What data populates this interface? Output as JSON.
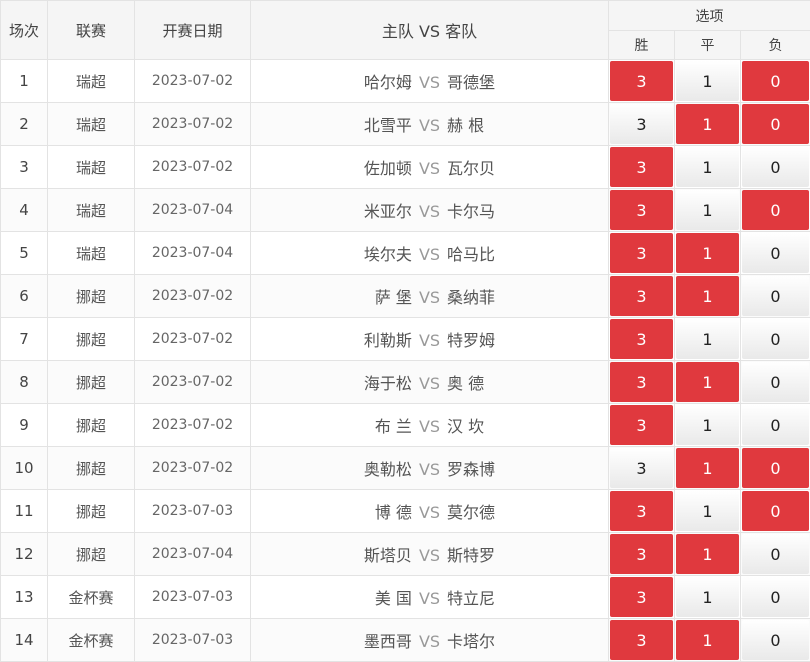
{
  "header": {
    "col_index": "场次",
    "col_league": "联赛",
    "col_date": "开赛日期",
    "col_teams": "主队 VS 客队",
    "col_options": "选项",
    "opt_win": "胜",
    "opt_draw": "平",
    "opt_loss": "负"
  },
  "colors": {
    "selected": "#e0393e",
    "unselected": "#f0f0f0"
  },
  "rows": [
    {
      "no": "1",
      "league": "瑞超",
      "date": "2023-07-02",
      "home": "哈尔姆",
      "vs": "VS",
      "away": "哥德堡",
      "win": "3",
      "draw": "1",
      "loss": "0",
      "win_sel": true,
      "draw_sel": false,
      "loss_sel": true
    },
    {
      "no": "2",
      "league": "瑞超",
      "date": "2023-07-02",
      "home": "北雪平",
      "vs": "VS",
      "away": "赫 根",
      "win": "3",
      "draw": "1",
      "loss": "0",
      "win_sel": false,
      "draw_sel": true,
      "loss_sel": true
    },
    {
      "no": "3",
      "league": "瑞超",
      "date": "2023-07-02",
      "home": "佐加顿",
      "vs": "VS",
      "away": "瓦尔贝",
      "win": "3",
      "draw": "1",
      "loss": "0",
      "win_sel": true,
      "draw_sel": false,
      "loss_sel": false
    },
    {
      "no": "4",
      "league": "瑞超",
      "date": "2023-07-04",
      "home": "米亚尔",
      "vs": "VS",
      "away": "卡尔马",
      "win": "3",
      "draw": "1",
      "loss": "0",
      "win_sel": true,
      "draw_sel": false,
      "loss_sel": true
    },
    {
      "no": "5",
      "league": "瑞超",
      "date": "2023-07-04",
      "home": "埃尔夫",
      "vs": "VS",
      "away": "哈马比",
      "win": "3",
      "draw": "1",
      "loss": "0",
      "win_sel": true,
      "draw_sel": true,
      "loss_sel": false
    },
    {
      "no": "6",
      "league": "挪超",
      "date": "2023-07-02",
      "home": "萨 堡",
      "vs": "VS",
      "away": "桑纳菲",
      "win": "3",
      "draw": "1",
      "loss": "0",
      "win_sel": true,
      "draw_sel": true,
      "loss_sel": false
    },
    {
      "no": "7",
      "league": "挪超",
      "date": "2023-07-02",
      "home": "利勒斯",
      "vs": "VS",
      "away": "特罗姆",
      "win": "3",
      "draw": "1",
      "loss": "0",
      "win_sel": true,
      "draw_sel": false,
      "loss_sel": false
    },
    {
      "no": "8",
      "league": "挪超",
      "date": "2023-07-02",
      "home": "海于松",
      "vs": "VS",
      "away": "奥 德",
      "win": "3",
      "draw": "1",
      "loss": "0",
      "win_sel": true,
      "draw_sel": true,
      "loss_sel": false
    },
    {
      "no": "9",
      "league": "挪超",
      "date": "2023-07-02",
      "home": "布 兰",
      "vs": "VS",
      "away": "汉 坎",
      "win": "3",
      "draw": "1",
      "loss": "0",
      "win_sel": true,
      "draw_sel": false,
      "loss_sel": false
    },
    {
      "no": "10",
      "league": "挪超",
      "date": "2023-07-02",
      "home": "奥勒松",
      "vs": "VS",
      "away": "罗森博",
      "win": "3",
      "draw": "1",
      "loss": "0",
      "win_sel": false,
      "draw_sel": true,
      "loss_sel": true
    },
    {
      "no": "11",
      "league": "挪超",
      "date": "2023-07-03",
      "home": "博 德",
      "vs": "VS",
      "away": "莫尔德",
      "win": "3",
      "draw": "1",
      "loss": "0",
      "win_sel": true,
      "draw_sel": false,
      "loss_sel": true
    },
    {
      "no": "12",
      "league": "挪超",
      "date": "2023-07-04",
      "home": "斯塔贝",
      "vs": "VS",
      "away": "斯特罗",
      "win": "3",
      "draw": "1",
      "loss": "0",
      "win_sel": true,
      "draw_sel": true,
      "loss_sel": false
    },
    {
      "no": "13",
      "league": "金杯赛",
      "date": "2023-07-03",
      "home": "美 国",
      "vs": "VS",
      "away": "特立尼",
      "win": "3",
      "draw": "1",
      "loss": "0",
      "win_sel": true,
      "draw_sel": false,
      "loss_sel": false
    },
    {
      "no": "14",
      "league": "金杯赛",
      "date": "2023-07-03",
      "home": "墨西哥",
      "vs": "VS",
      "away": "卡塔尔",
      "win": "3",
      "draw": "1",
      "loss": "0",
      "win_sel": true,
      "draw_sel": true,
      "loss_sel": false
    }
  ]
}
